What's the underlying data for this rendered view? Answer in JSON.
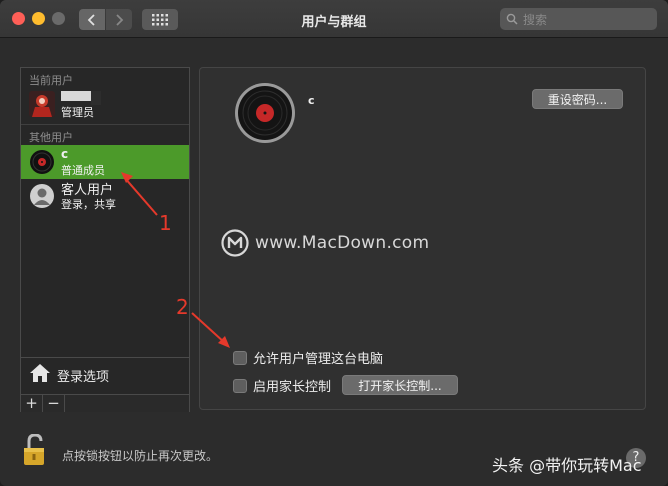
{
  "window": {
    "title": "用户与群组"
  },
  "search": {
    "placeholder": "搜索"
  },
  "sidebar": {
    "current_label": "当前用户",
    "current_user": {
      "name": "",
      "role": "管理员"
    },
    "other_label": "其他用户",
    "other_users": [
      {
        "name": "c",
        "role": "普通成员",
        "selected": true
      },
      {
        "name": "客人用户",
        "role": "登录，共享",
        "selected": false
      }
    ],
    "login_options": "登录选项",
    "add": "+",
    "remove": "−"
  },
  "panel": {
    "username": "c",
    "reset_password": "重设密码...",
    "allow_admin": "允许用户管理这台电脑",
    "allow_admin_checked": false,
    "parental_controls": "启用家长控制",
    "parental_controls_checked": false,
    "open_parental": "打开家长控制..."
  },
  "watermark": {
    "text": "www.MacDown.com"
  },
  "footer": {
    "lock_text": "点按锁按钮以防止再次更改。",
    "help": "?",
    "credit": "头条 @带你玩转Mac"
  },
  "annotations": {
    "label1": "1",
    "label2": "2"
  },
  "colors": {
    "selected": "#4c9a2a",
    "arrow": "#e5392b"
  }
}
